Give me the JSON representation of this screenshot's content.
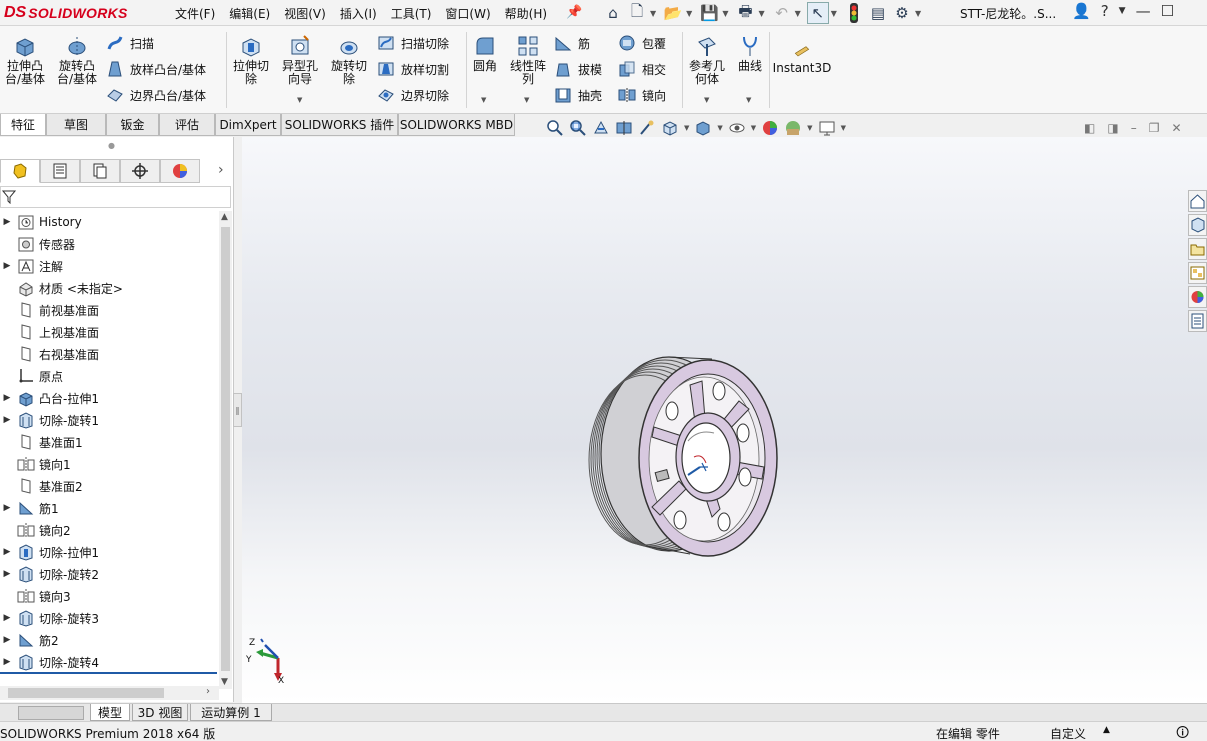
{
  "app": {
    "logo_mark": "DS",
    "logo_text": "SOLIDWORKS",
    "doc_title": "STT-尼龙轮。.S...",
    "menus": [
      "文件(F)",
      "编辑(E)",
      "视图(V)",
      "插入(I)",
      "工具(T)",
      "窗口(W)",
      "帮助(H)"
    ]
  },
  "ribbon": {
    "extrude_boss": "拉伸凸台/基体",
    "revolve_boss": "旋转凸台/基体",
    "sweep": "扫描",
    "loft": "放样凸台/基体",
    "boundary_boss": "边界凸台/基体",
    "extrude_cut": "拉伸切除",
    "hole_wizard": "异型孔向导",
    "revolve_cut": "旋转切除",
    "swept_cut": "扫描切除",
    "lofted_cut": "放样切割",
    "boundary_cut": "边界切除",
    "fillet": "圆角",
    "linear_pattern": "线性阵列",
    "rib": "筋",
    "draft": "拔模",
    "shell": "抽壳",
    "wrap": "包覆",
    "intersect": "相交",
    "mirror": "镜向",
    "ref_geometry": "参考几何体",
    "curves": "曲线",
    "instant3d": "Instant3D"
  },
  "command_tabs": [
    "特征",
    "草图",
    "钣金",
    "评估",
    "DimXpert",
    "SOLIDWORKS 插件",
    "SOLIDWORKS MBD"
  ],
  "feature_tree": [
    {
      "label": "History",
      "icon": "history-icon",
      "expand": true
    },
    {
      "label": "传感器",
      "icon": "sensor-icon",
      "expand": false
    },
    {
      "label": "注解",
      "icon": "annotation-icon",
      "expand": true
    },
    {
      "label": "材质 <未指定>",
      "icon": "material-icon",
      "expand": false
    },
    {
      "label": "前视基准面",
      "icon": "plane-icon",
      "expand": false
    },
    {
      "label": "上视基准面",
      "icon": "plane-icon",
      "expand": false
    },
    {
      "label": "右视基准面",
      "icon": "plane-icon",
      "expand": false
    },
    {
      "label": "原点",
      "icon": "origin-icon",
      "expand": false
    },
    {
      "label": "凸台-拉伸1",
      "icon": "extrude-icon",
      "expand": true
    },
    {
      "label": "切除-旋转1",
      "icon": "cut-revolve-icon",
      "expand": true
    },
    {
      "label": "基准面1",
      "icon": "plane-icon",
      "expand": false
    },
    {
      "label": "镜向1",
      "icon": "mirror-icon",
      "expand": false
    },
    {
      "label": "基准面2",
      "icon": "plane-icon",
      "expand": false
    },
    {
      "label": "筋1",
      "icon": "rib-icon",
      "expand": true
    },
    {
      "label": "镜向2",
      "icon": "mirror-icon",
      "expand": false
    },
    {
      "label": "切除-拉伸1",
      "icon": "cut-extrude-icon",
      "expand": true
    },
    {
      "label": "切除-旋转2",
      "icon": "cut-revolve-icon",
      "expand": true
    },
    {
      "label": "镜向3",
      "icon": "mirror-icon",
      "expand": false
    },
    {
      "label": "切除-旋转3",
      "icon": "cut-revolve-icon",
      "expand": true
    },
    {
      "label": "筋2",
      "icon": "rib-icon",
      "expand": true
    },
    {
      "label": "切除-旋转4",
      "icon": "cut-revolve-icon",
      "expand": true
    }
  ],
  "triad": {
    "z": "Z",
    "y": "Y",
    "x": "X"
  },
  "bottom_tabs": [
    "模型",
    "3D 视图",
    "运动算例 1"
  ],
  "status": {
    "product": "SOLIDWORKS Premium 2018 x64 版",
    "editing": "在编辑 零件",
    "custom": "自定义"
  },
  "colors": {
    "brand_red": "#d6001c",
    "part_face": "#d8c9e0",
    "part_edge": "#3a3a3a",
    "selection_blue": "#1f5aa6"
  }
}
